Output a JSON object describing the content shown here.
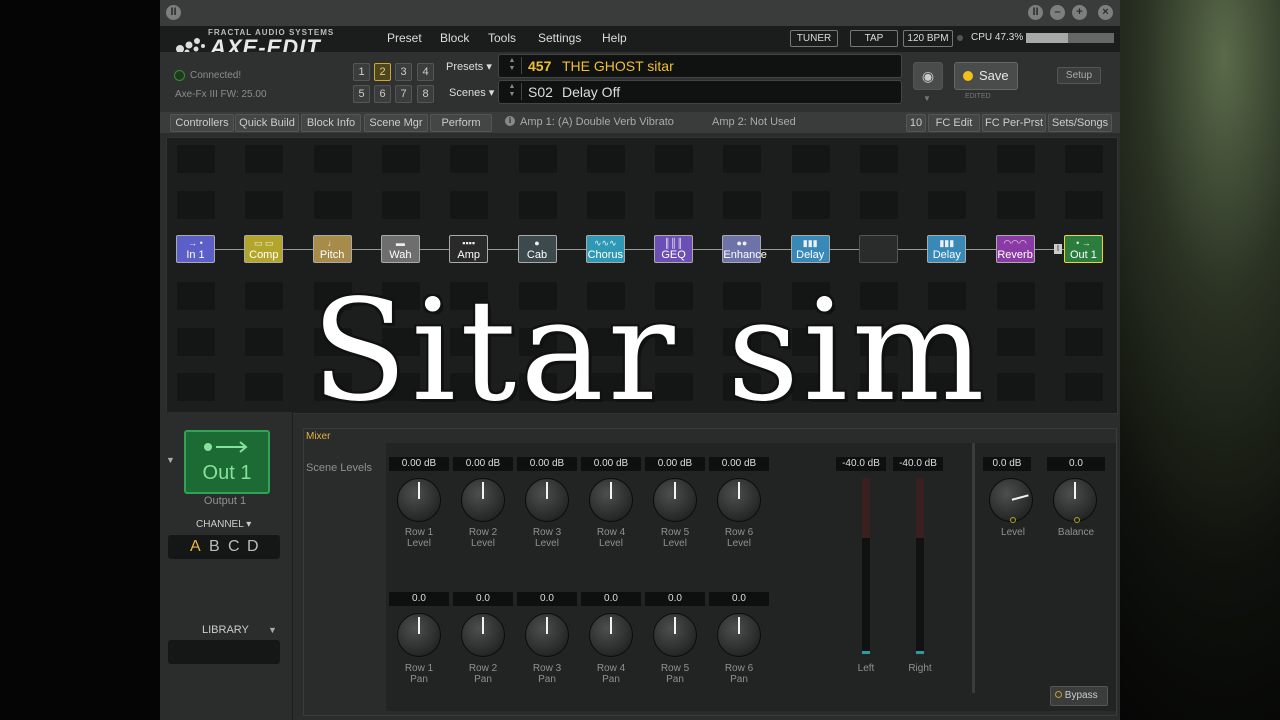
{
  "app": {
    "logo_sub": "FRACTAL AUDIO SYSTEMS",
    "logo_main": "AXE-EDIT III"
  },
  "menu": [
    "Preset",
    "Block",
    "Tools",
    "Settings",
    "Help"
  ],
  "header": {
    "tuner": "TUNER",
    "tap": "TAP",
    "bpm": "120 BPM",
    "cpu": "CPU 47.3%",
    "cpu_value": 0.473
  },
  "status": {
    "connected": "Connected!",
    "firmware": "Axe-Fx III FW: 25.00"
  },
  "preset_buttons": [
    "1",
    "2",
    "3",
    "4",
    "5",
    "6",
    "7",
    "8"
  ],
  "preset_buttons_selected": "2",
  "presets_label": "Presets",
  "scenes_label": "Scenes",
  "preset": {
    "number": "457",
    "name": "THE GHOST sitar",
    "color": "#f0c030"
  },
  "scene": {
    "number": "S02",
    "name": "Delay Off"
  },
  "save": {
    "label": "Save",
    "edited": "EDITED"
  },
  "setup_label": "Setup",
  "toolbar": {
    "left": [
      "Controllers",
      "Quick Build",
      "Block Info",
      "Scene Mgr",
      "Perform"
    ],
    "amp1": "Amp 1: (A) Double Verb Vibrato",
    "amp2": "Amp 2: Not Used",
    "right": [
      "10",
      "FC Edit",
      "FC Per-Prst",
      "Sets/Songs"
    ]
  },
  "blocks": [
    {
      "label": "In 1",
      "color": "#5b5fc7"
    },
    {
      "label": "Comp",
      "color": "#b3a52a"
    },
    {
      "label": "Pitch",
      "color": "#a78b4a"
    },
    {
      "label": "Wah",
      "color": "#6e6e6e"
    },
    {
      "label": "Amp",
      "color": "#2a2a2a"
    },
    {
      "label": "Cab",
      "color": "#3d4a4d"
    },
    {
      "label": "Chorus",
      "color": "#2f98b5"
    },
    {
      "label": "GEQ",
      "color": "#6c4fb5"
    },
    {
      "label": "Enhance",
      "color": "#6d73a8"
    },
    {
      "label": "Delay",
      "color": "#3989b8"
    },
    {
      "label": "",
      "color": "#2a2c2b"
    },
    {
      "label": "Delay",
      "color": "#3989b8"
    },
    {
      "label": "Reverb",
      "color": "#8a3aa5"
    },
    {
      "label": "Out 1",
      "color": "#2b7d3e"
    }
  ],
  "output": {
    "title": "Out 1",
    "subtitle": "Output 1"
  },
  "channel_label": "CHANNEL",
  "channels": [
    "A",
    "B",
    "C",
    "D"
  ],
  "channel_selected": "A",
  "library_label": "LIBRARY",
  "mixer": {
    "title": "Mixer",
    "scene_levels": "Scene Levels",
    "level_values": [
      "0.00 dB",
      "0.00 dB",
      "0.00 dB",
      "0.00 dB",
      "0.00 dB",
      "0.00 dB"
    ],
    "level_labels": [
      "Row 1\nLevel",
      "Row 2\nLevel",
      "Row 3\nLevel",
      "Row 4\nLevel",
      "Row 5\nLevel",
      "Row 6\nLevel"
    ],
    "pan_values": [
      "0.0",
      "0.0",
      "0.0",
      "0.0",
      "0.0",
      "0.0"
    ],
    "pan_labels": [
      "Row 1\nPan",
      "Row 2\nPan",
      "Row 3\nPan",
      "Row 4\nPan",
      "Row 5\nPan",
      "Row 6\nPan"
    ],
    "meters": [
      {
        "value": "-40.0 dB",
        "label": "Left"
      },
      {
        "value": "-40.0 dB",
        "label": "Right"
      }
    ],
    "level_value": "0.0 dB",
    "level_label": "Level",
    "balance_value": "0.0",
    "balance_label": "Balance",
    "bypass": "Bypass"
  },
  "overlay_text": "Sitar sim"
}
